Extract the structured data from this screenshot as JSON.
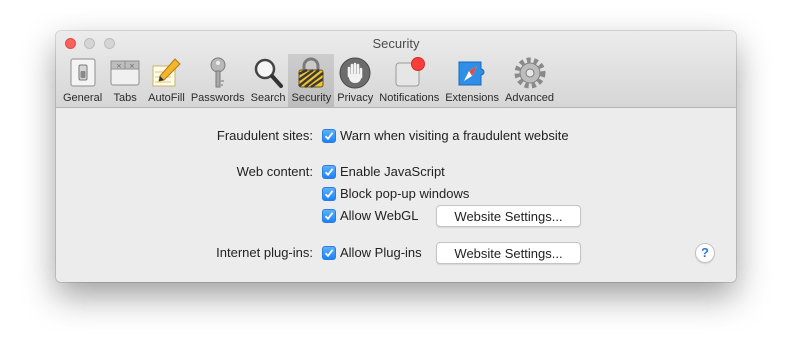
{
  "window": {
    "title": "Security"
  },
  "toolbar": {
    "tabs": [
      {
        "label": "General",
        "icon": "general-switch-icon",
        "selected": false
      },
      {
        "label": "Tabs",
        "icon": "tabs-icon",
        "selected": false
      },
      {
        "label": "AutoFill",
        "icon": "pencil-icon",
        "selected": false
      },
      {
        "label": "Passwords",
        "icon": "key-icon",
        "selected": false
      },
      {
        "label": "Search",
        "icon": "magnifier-icon",
        "selected": false
      },
      {
        "label": "Security",
        "icon": "padlock-icon",
        "selected": true
      },
      {
        "label": "Privacy",
        "icon": "hand-icon",
        "selected": false
      },
      {
        "label": "Notifications",
        "icon": "notification-badge-icon",
        "selected": false
      },
      {
        "label": "Extensions",
        "icon": "puzzle-compass-icon",
        "selected": false
      },
      {
        "label": "Advanced",
        "icon": "gear-icon",
        "selected": false
      }
    ]
  },
  "security": {
    "fraudulent_label": "Fraudulent sites:",
    "fraudulent_option": {
      "label": "Warn when visiting a fraudulent website",
      "checked": true
    },
    "web_content_label": "Web content:",
    "javascript": {
      "label": "Enable JavaScript",
      "checked": true
    },
    "popups": {
      "label": "Block pop-up windows",
      "checked": true
    },
    "webgl": {
      "label": "Allow WebGL",
      "checked": true,
      "button": "Website Settings..."
    },
    "plugins_label": "Internet plug-ins:",
    "plugins": {
      "label": "Allow Plug-ins",
      "checked": true,
      "button": "Website Settings..."
    },
    "help": "?"
  },
  "colors": {
    "accent": "#1a82fb",
    "close_button": "#fc615d",
    "notification_badge": "#fc3d39"
  }
}
